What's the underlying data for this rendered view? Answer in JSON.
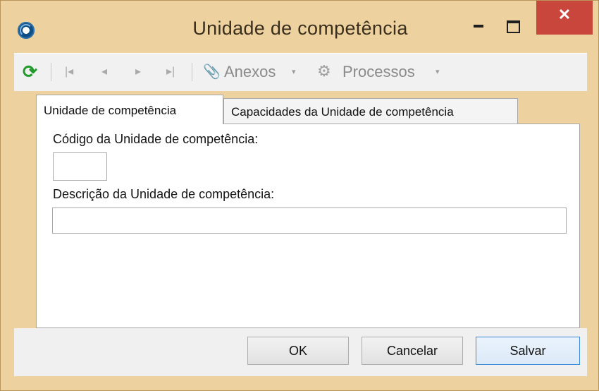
{
  "window": {
    "title": "Unidade de competência",
    "close_glyph": "✕",
    "colors": {
      "frame": "#edd2a0",
      "close": "#c9463d",
      "accent": "#3c8ad9"
    }
  },
  "toolbar": {
    "refresh_glyph": "⟳",
    "first_glyph": "|◂",
    "prev_glyph": "◂",
    "next_glyph": "▸",
    "last_glyph": "▸|",
    "attachments_label": "Anexos",
    "processes_label": "Processos",
    "dropdown_glyph": "▾"
  },
  "tabs": [
    {
      "label": "Unidade de competência",
      "active": true
    },
    {
      "label": "Capacidades da Unidade de competência",
      "active": false
    }
  ],
  "form": {
    "code_label": "Código da Unidade de competência:",
    "code_value": "",
    "description_label": "Descrição da Unidade de competência:",
    "description_value": ""
  },
  "buttons": {
    "ok": "OK",
    "cancel": "Cancelar",
    "save": "Salvar"
  },
  "icons": [
    "app-icon",
    "refresh-icon",
    "first-record-icon",
    "prev-record-icon",
    "next-record-icon",
    "last-record-icon",
    "paperclip-icon",
    "gears-icon",
    "minimize-icon",
    "maximize-icon",
    "close-icon"
  ]
}
